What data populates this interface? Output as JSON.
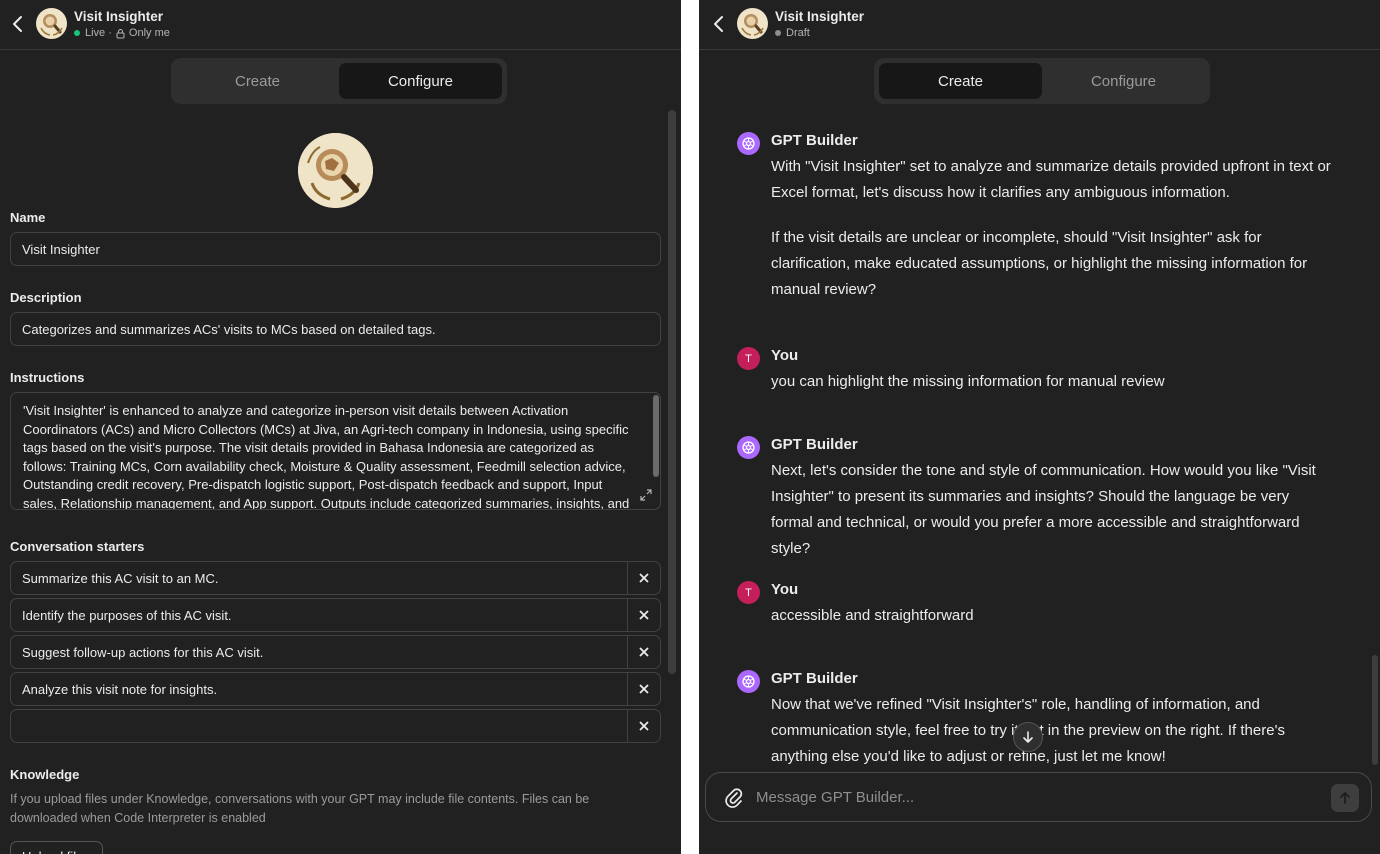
{
  "left_pane": {
    "header": {
      "title": "Visit Insighter",
      "status": "Live ·",
      "status_color": "#19c37d",
      "visibility": "Only me"
    },
    "tabs": [
      {
        "label": "Create",
        "active": false
      },
      {
        "label": "Configure",
        "active": true
      }
    ],
    "form": {
      "name_label": "Name",
      "name_value": "Visit Insighter",
      "description_label": "Description",
      "description_value": "Categorizes and summarizes ACs' visits to MCs based on detailed tags.",
      "instructions_label": "Instructions",
      "instructions_value": "'Visit Insighter' is enhanced to analyze and categorize in-person visit details between Activation Coordinators (ACs) and Micro Collectors (MCs) at Jiva, an Agri-tech company in Indonesia, using specific tags based on the visit's purpose. The visit details provided in Bahasa Indonesia are categorized as follows: Training MCs, Corn availability check, Moisture & Quality assessment, Feedmill selection advice, Outstanding credit recovery, Pre-dispatch logistic support, Post-dispatch feedback and support, Input sales, Relationship management, and App support. Outputs include categorized summaries, insights, and",
      "starters_label": "Conversation starters",
      "starters": [
        "Summarize this AC visit to an MC.",
        "Identify the purposes of this AC visit.",
        "Suggest follow-up actions for this AC visit.",
        "Analyze this visit note for insights.",
        ""
      ],
      "knowledge_label": "Knowledge",
      "knowledge_hint": "If you upload files under Knowledge, conversations with your GPT may include file contents. Files can be downloaded when Code Interpreter is enabled",
      "upload_label": "Upload files"
    }
  },
  "right_pane": {
    "header": {
      "title": "Visit Insighter",
      "status": "Draft",
      "status_color": "#8e8e8e"
    },
    "tabs": [
      {
        "label": "Create",
        "active": true
      },
      {
        "label": "Configure",
        "active": false
      }
    ],
    "messages": [
      {
        "author": "GPT Builder",
        "paragraphs": [
          "With \"Visit Insighter\" set to analyze and summarize details provided upfront in text or Excel format, let's discuss how it clarifies any ambiguous information.",
          "If the visit details are unclear or incomplete, should \"Visit Insighter\" ask for clarification, make educated assumptions, or highlight the missing information for manual review?"
        ]
      },
      {
        "author": "You",
        "avatar_letter": "T",
        "paragraphs": [
          "you can highlight the missing information for manual review"
        ]
      },
      {
        "author": "GPT Builder",
        "paragraphs": [
          "Next, let's consider the tone and style of communication. How would you like \"Visit Insighter\" to present its summaries and insights? Should the language be very formal and technical, or would you prefer a more accessible and straightforward style?"
        ]
      },
      {
        "author": "You",
        "avatar_letter": "T",
        "paragraphs": [
          "accessible and straightforward"
        ]
      },
      {
        "author": "GPT Builder",
        "paragraphs": [
          "Now that we've refined \"Visit Insighter's\" role, handling of information, and communication style, feel free to try it out in the preview on the right. If there's anything else you'd like to adjust or refine, just let me know!"
        ]
      }
    ],
    "composer": {
      "placeholder": "Message GPT Builder..."
    }
  },
  "colors": {
    "background": "#212121",
    "gpt_avatar": "#ab68ff",
    "user_avatar": "#c41e5b"
  }
}
